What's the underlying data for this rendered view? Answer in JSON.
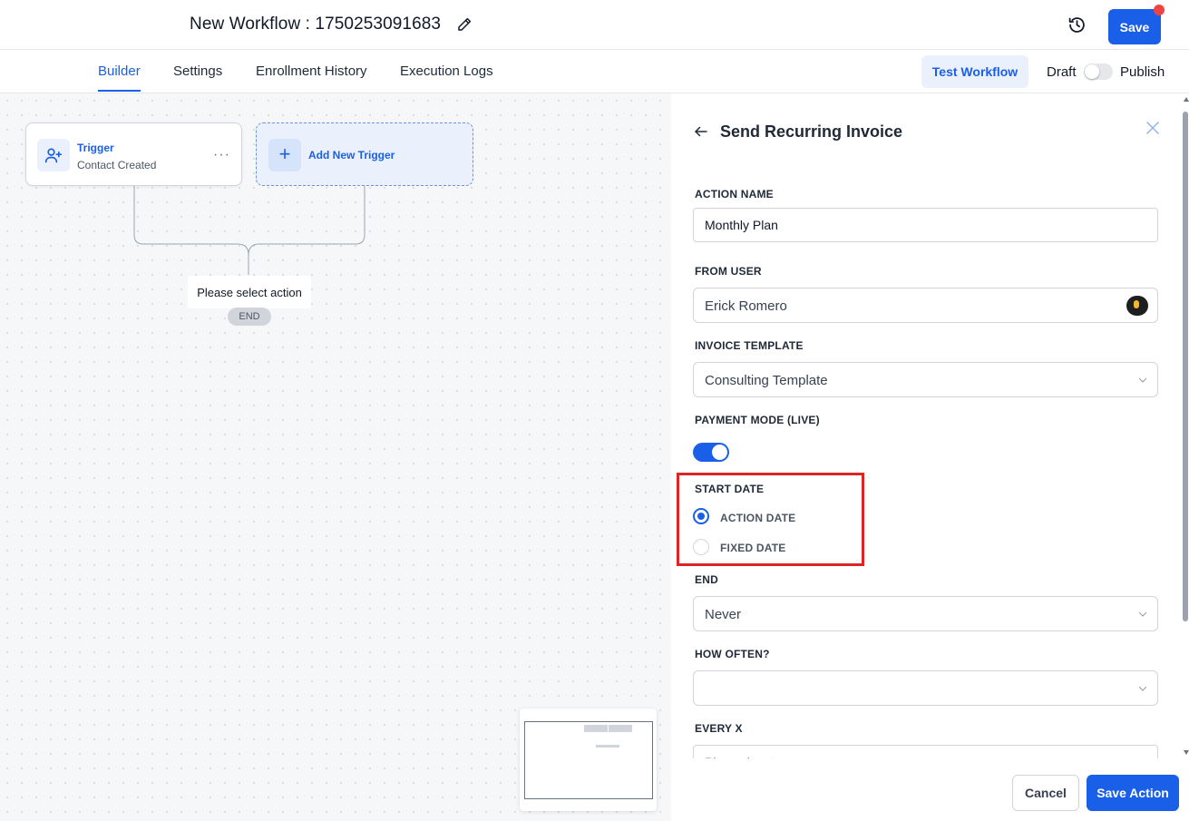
{
  "header": {
    "workflow_title": "New Workflow : 1750253091683",
    "save_label": "Save"
  },
  "tabs": [
    {
      "label": "Builder",
      "active": true
    },
    {
      "label": "Settings",
      "active": false
    },
    {
      "label": "Enrollment History",
      "active": false
    },
    {
      "label": "Execution Logs",
      "active": false
    }
  ],
  "toolbar": {
    "test_workflow_label": "Test Workflow",
    "draft_label": "Draft",
    "publish_label": "Publish",
    "published": false
  },
  "canvas": {
    "trigger": {
      "title": "Trigger",
      "subtitle": "Contact Created",
      "more": "···"
    },
    "add_trigger": {
      "plus": "+",
      "label": "Add New Trigger"
    },
    "select_action_label": "Please select action",
    "end_label": "END"
  },
  "panel": {
    "title": "Send Recurring Invoice",
    "action_name": {
      "label": "ACTION NAME",
      "value": "Monthly Plan"
    },
    "from_user": {
      "label": "FROM USER",
      "value": "Erick Romero"
    },
    "invoice_template": {
      "label": "INVOICE TEMPLATE",
      "value": "Consulting Template"
    },
    "payment_mode": {
      "label": "PAYMENT MODE (LIVE)",
      "enabled": true
    },
    "start_date": {
      "label": "START DATE",
      "options": [
        {
          "label": "ACTION DATE",
          "selected": true
        },
        {
          "label": "FIXED DATE",
          "selected": false
        }
      ]
    },
    "end": {
      "label": "END",
      "value": "Never"
    },
    "how_often": {
      "label": "HOW OFTEN?",
      "value": ""
    },
    "every_x": {
      "label": "EVERY X",
      "placeholder": "Please input"
    },
    "cancel_label": "Cancel",
    "save_action_label": "Save Action"
  },
  "colors": {
    "accent": "#1a5fe8",
    "highlight": "#dc2626",
    "notification_dot": "#ef4444"
  }
}
